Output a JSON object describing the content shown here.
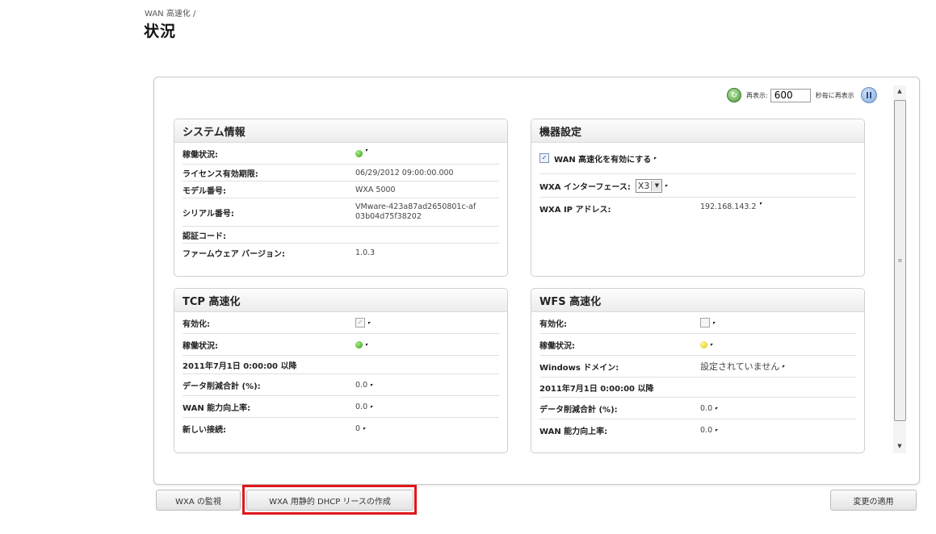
{
  "breadcrumb": "WAN 高速化 /",
  "page_title": "状況",
  "refresh": {
    "label": "再表示:",
    "interval_value": "600",
    "suffix": "秒毎に再表示"
  },
  "system_info": {
    "title": "システム情報",
    "rows": [
      {
        "label": "稼働状況:",
        "value": ""
      },
      {
        "label": "ライセンス有効期限:",
        "value": "06/29/2012 09:00:00.000"
      },
      {
        "label": "モデル番号:",
        "value": "WXA 5000"
      },
      {
        "label": "シリアル番号:",
        "value": "VMware-423a87ad2650801c-af03b04d75f38202"
      },
      {
        "label": "認証コード:",
        "value": ""
      },
      {
        "label": "ファームウェア バージョン:",
        "value": "1.0.3"
      }
    ]
  },
  "device_settings": {
    "title": "機器設定",
    "enable_wan_label": "WAN 高速化を有効にする",
    "interface_label": "WXA インターフェース:",
    "interface_value": "X3",
    "ip_label": "WXA IP アドレス:",
    "ip_value": "192.168.143.2"
  },
  "tcp": {
    "title": "TCP 高速化",
    "rows": [
      {
        "label": "有効化:",
        "value": ""
      },
      {
        "label": "稼働状況:",
        "value": ""
      },
      {
        "label": "2011年7月1日 0:00:00 以降",
        "value": ""
      },
      {
        "label": "データ削減合計 (%):",
        "value": "0.0"
      },
      {
        "label": "WAN 能力向上率:",
        "value": "0.0"
      },
      {
        "label": "新しい接続:",
        "value": "0"
      }
    ]
  },
  "wfs": {
    "title": "WFS 高速化",
    "rows": [
      {
        "label": "有効化:",
        "value": ""
      },
      {
        "label": "稼働状況:",
        "value": ""
      },
      {
        "label": "Windows ドメイン:",
        "value": "設定されていません"
      },
      {
        "label": "2011年7月1日 0:00:00 以降",
        "value": ""
      },
      {
        "label": "データ削減合計 (%):",
        "value": "0.0"
      },
      {
        "label": "WAN 能力向上率:",
        "value": "0.0"
      }
    ]
  },
  "buttons": {
    "monitor": "WXA の監視",
    "dhcp": "WXA 用静的 DHCP リースの作成",
    "apply": "変更の適用"
  },
  "colors": {
    "highlight": "#e0161b",
    "status_green": "#2b9a12",
    "status_yellow": "#e0c600"
  }
}
